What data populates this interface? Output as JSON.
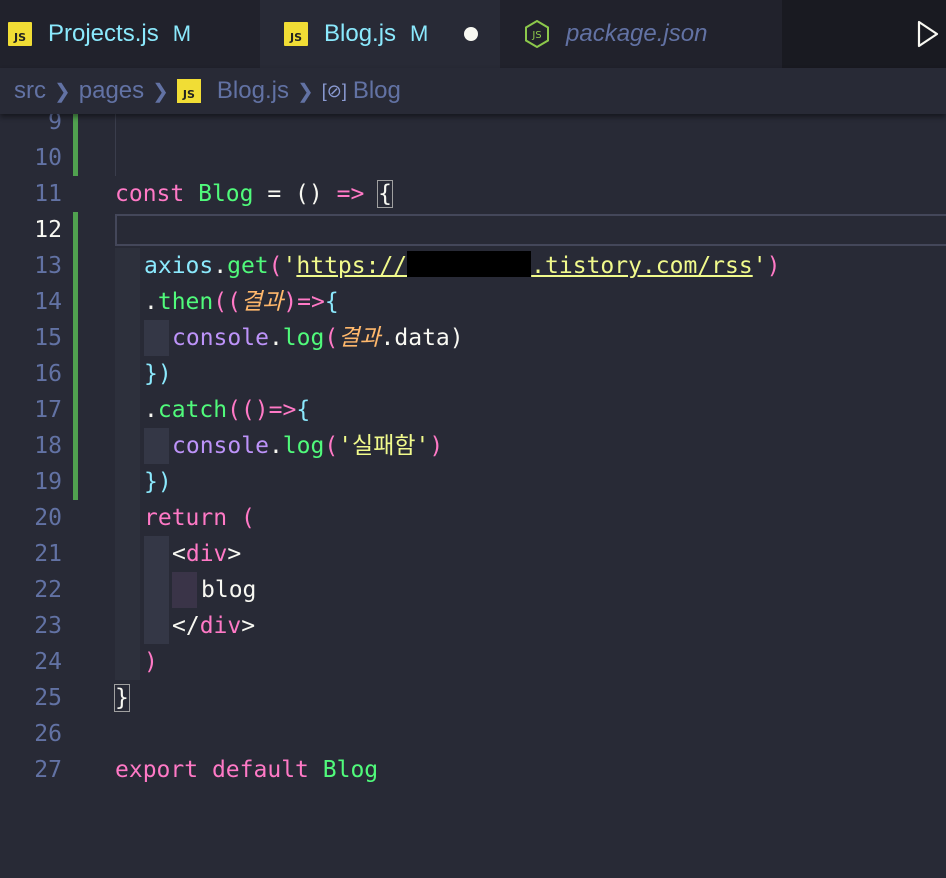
{
  "tabs": [
    {
      "icon": "JS",
      "name": "Projects.js",
      "status": "M"
    },
    {
      "icon": "JS",
      "name": "Blog.js",
      "status": "M"
    },
    {
      "name": "package.json"
    }
  ],
  "breadcrumb": {
    "items": [
      "src",
      "pages",
      "Blog.js",
      "Blog"
    ],
    "file_icon": "JS",
    "symbol_icon": "[⊘]"
  },
  "editor": {
    "line_numbers": [
      "9",
      "10",
      "11",
      "12",
      "13",
      "14",
      "15",
      "16",
      "17",
      "18",
      "19",
      "20",
      "21",
      "22",
      "23",
      "24",
      "25",
      "26",
      "27"
    ],
    "active_line": "12",
    "code": {
      "l11": {
        "kw": "const",
        "name": "Blog",
        "rest": " = () ",
        "arrow": "=>",
        "brace": "{"
      },
      "l13": {
        "obj": "axios",
        "dot": ".",
        "fn": "get",
        "open": "(",
        "q1": "'",
        "url_a": "https://",
        "url_b": ".tistory.com/rss",
        "q2": "'",
        "close": ")"
      },
      "l14": {
        "dot": ".",
        "fn": "then",
        "p": "((",
        "param": "결과",
        "p2": ")",
        "arrow": "=>",
        "brace": "{"
      },
      "l15": {
        "obj": "console",
        "dot": ".",
        "fn": "log",
        "p": "(",
        "param": "결과",
        "rest": ".data)"
      },
      "l16": {
        "text": "})"
      },
      "l17": {
        "dot": ".",
        "fn": "catch",
        "p": "(()",
        "arrow": "=>",
        "brace": "{"
      },
      "l18": {
        "obj": "console",
        "dot": ".",
        "fn": "log",
        "p": "(",
        "str": "'실패함'",
        "close": ")"
      },
      "l19": {
        "text": "})"
      },
      "l20": {
        "kw": "return",
        "p": " ("
      },
      "l21": {
        "lt": "<",
        "tag": "div",
        "gt": ">"
      },
      "l22": {
        "text": "blog"
      },
      "l23": {
        "lt": "</",
        "tag": "div",
        "gt": ">"
      },
      "l24": {
        "text": ")"
      },
      "l25": {
        "text": "}"
      },
      "l27": {
        "kw1": "export",
        "kw2": "default",
        "name": "Blog"
      }
    }
  }
}
